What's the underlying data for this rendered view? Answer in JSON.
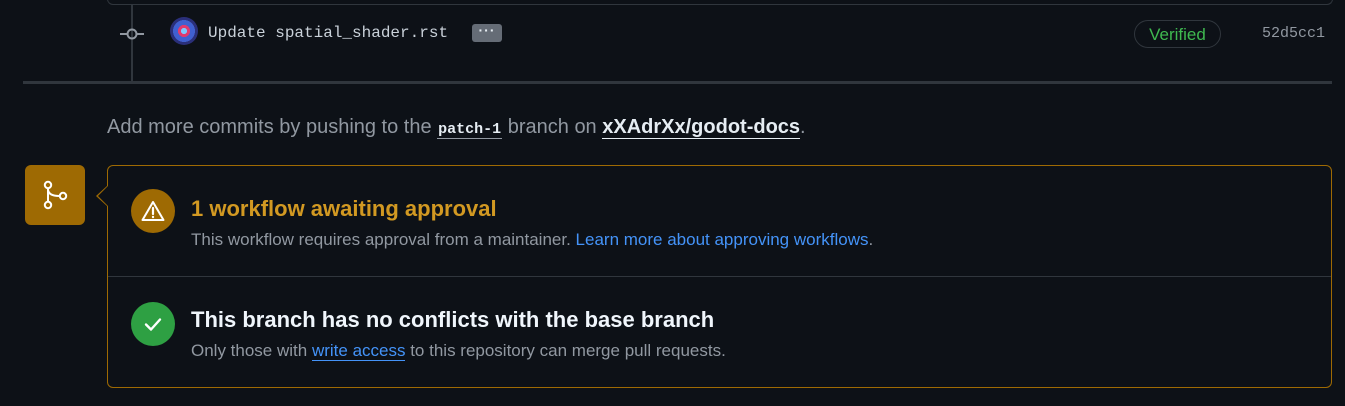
{
  "commit": {
    "message": "Update spatial_shader.rst",
    "more_label": "···",
    "verified_label": "Verified",
    "sha": "52d5cc1"
  },
  "hint": {
    "prefix": "Add more commits by pushing to the ",
    "branch": "patch-1",
    "middle": " branch on ",
    "repo": "xXAdrXx/godot-docs",
    "suffix": "."
  },
  "workflow": {
    "title": "1 workflow awaiting approval",
    "text": "This workflow requires approval from a maintainer. ",
    "link": "Learn more about approving workflows",
    "suffix": "."
  },
  "conflicts": {
    "title": "This branch has no conflicts with the base branch",
    "text_before": "Only those with ",
    "link": "write access",
    "text_after": " to this repository can merge pull requests."
  },
  "colors": {
    "background": "#0d1117",
    "warning": "#9e6a03",
    "warning_text": "#d29922",
    "success": "#2ea043",
    "link": "#4493f8"
  },
  "icons": {
    "commit": "git-commit-icon",
    "merge": "git-merge-icon",
    "warning": "alert-icon",
    "success": "check-icon"
  }
}
